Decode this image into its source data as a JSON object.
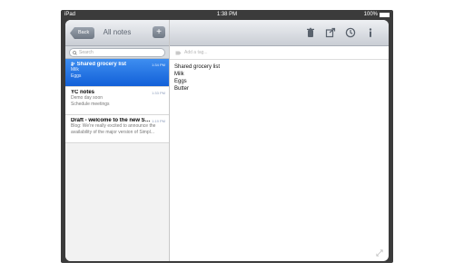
{
  "status_bar": {
    "carrier": "iPad",
    "time": "1:38 PM",
    "battery": "100%"
  },
  "sidebar": {
    "back_label": "Back",
    "title": "All notes",
    "add_label": "+",
    "search_placeholder": "Search"
  },
  "notes": [
    {
      "title": "Shared grocery list",
      "line1": "Milk",
      "line2": "Eggs",
      "time": "1:34 PM",
      "shared": true
    },
    {
      "title": "YC notes",
      "line1": "Demo day soon",
      "line2": "Schedule meetings",
      "time": "1:33 PM",
      "shared": false
    },
    {
      "title": "Draft - welcome to the new Si...",
      "line1": "Blog: We're really excited to announce the",
      "line2": "availability of the major version of Simpl...",
      "time": "1:19 PM",
      "shared": false
    }
  ],
  "editor": {
    "tag_placeholder": "Add a tag...",
    "lines": [
      "Shared grocery list",
      "Milk",
      "Eggs",
      "Butter"
    ]
  },
  "icons": [
    "trash-icon",
    "share-icon",
    "clock-icon",
    "info-icon",
    "expand-icon",
    "search-icon",
    "tag-icon"
  ],
  "colors": {
    "accent": "#1a6fe0",
    "toolbar_top": "#eef0f3",
    "toolbar_bottom": "#c9cdd4"
  }
}
